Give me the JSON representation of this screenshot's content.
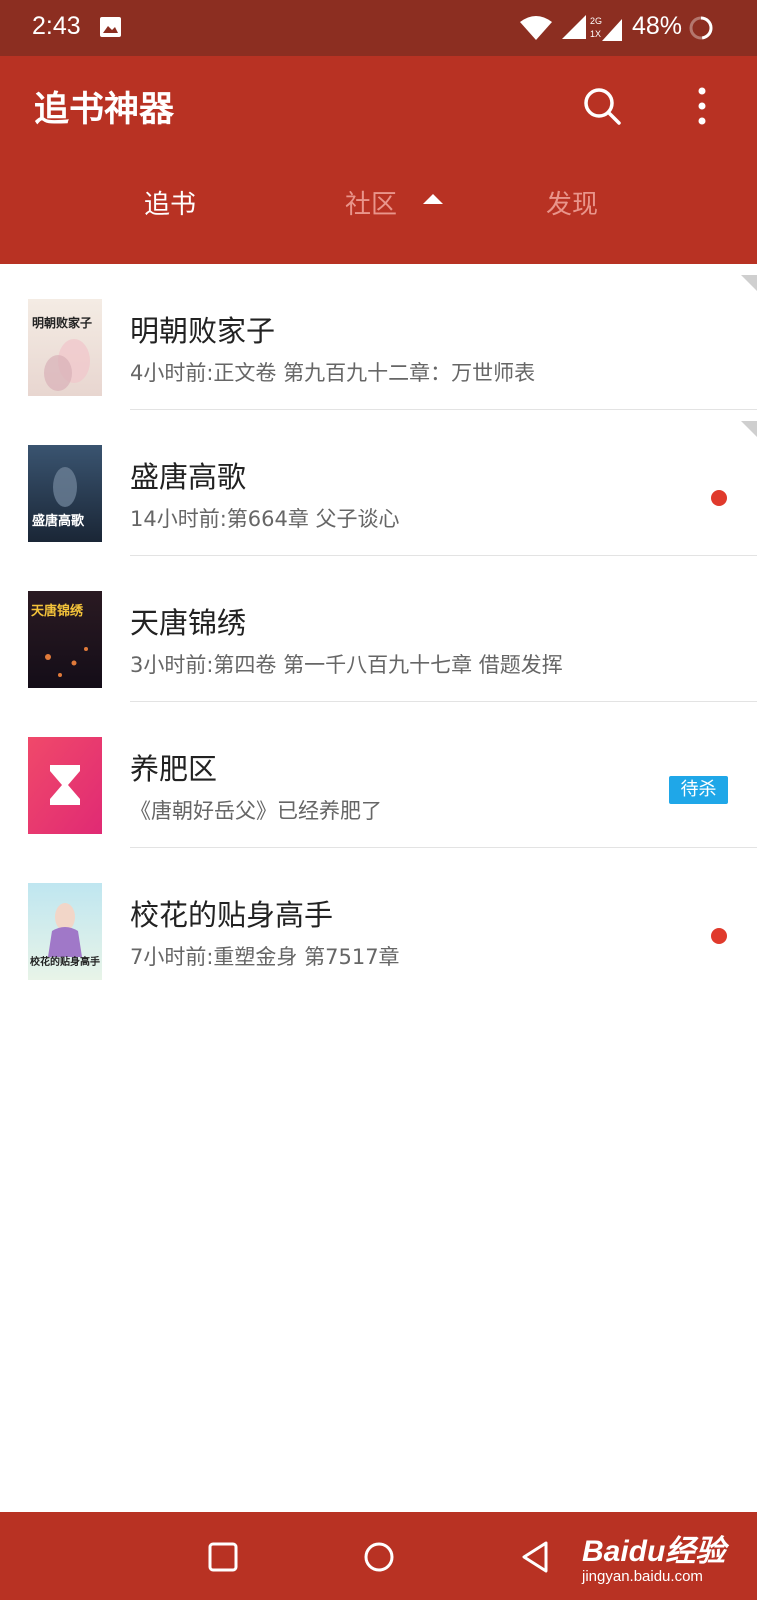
{
  "status_bar": {
    "time": "2:43",
    "battery": "48%",
    "network_label_top": "2G",
    "network_label_bottom": "1X",
    "icons": [
      "gallery-icon",
      "wifi-icon",
      "signal-icon",
      "network-icon",
      "battery-icon"
    ]
  },
  "header": {
    "title": "追书神器",
    "icons": [
      "search-icon",
      "more-vert-icon"
    ],
    "tabs": [
      {
        "label": "追书",
        "active": true
      },
      {
        "label": "社区",
        "active": false
      },
      {
        "label": "发现",
        "active": false
      }
    ]
  },
  "books": [
    {
      "title": "明朝败家子",
      "subtitle": "4小时前:正文卷 第九百九十二章：万世师表",
      "cover_text": "明朝败家子",
      "unread": false
    },
    {
      "title": "盛唐高歌",
      "subtitle": "14小时前:第664章 父子谈心",
      "cover_text": "盛唐高歌",
      "unread": true
    },
    {
      "title": "天唐锦绣",
      "subtitle": "3小时前:第四卷 第一千八百九十七章 借题发挥",
      "cover_text": "天唐锦绣",
      "unread": false
    },
    {
      "title": "养肥区",
      "subtitle": "《唐朝好岳父》已经养肥了",
      "badge": "待杀",
      "icon": "hourglass-icon"
    },
    {
      "title": "校花的贴身高手",
      "subtitle": "7小时前:重塑金身 第7517章",
      "cover_text": "校花的贴身高手",
      "unread": true
    }
  ],
  "nav_bar": {
    "icons": [
      "recent-apps-icon",
      "home-icon",
      "back-icon"
    ]
  },
  "watermark": {
    "logo": "Baidu经验",
    "url": "jingyan.baidu.com"
  },
  "colors": {
    "status_bar": "#8c2e21",
    "header": "#b83223",
    "tab_inactive": "#e9958b",
    "unread_dot": "#e03a2c",
    "badge": "#1fa7e8"
  }
}
